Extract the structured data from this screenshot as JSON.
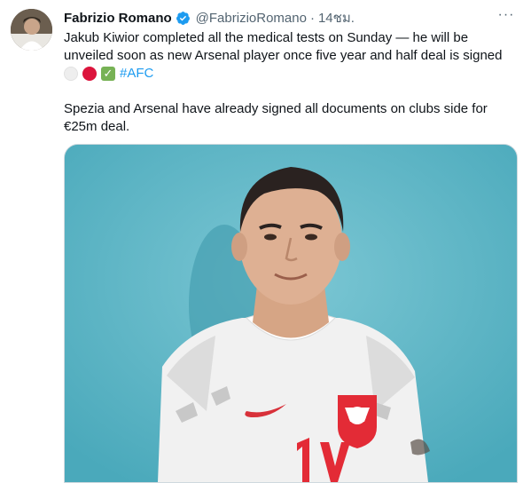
{
  "tweet": {
    "author_name": "Fabrizio Romano",
    "handle": "@FabrizioRomano",
    "separator": "·",
    "time": "14ชม.",
    "more_label": "···",
    "text_line1": "Jakub Kiwior completed all the medical tests on Sunday — he will be",
    "text_line2": "unveiled soon as new Arsenal player once five year and half deal is signed",
    "hashtag": "#AFC",
    "text_para2_line1": "Spezia and Arsenal have already signed all documents on clubs side for",
    "text_para2_line2": "€25m deal.",
    "check_glyph": "✓"
  },
  "icons": {
    "verified": "verified-badge-icon",
    "more": "more-options-icon",
    "flag_white": "white-circle-emoji",
    "flag_red": "red-circle-emoji",
    "check": "check-mark-emoji"
  },
  "colors": {
    "link": "#1d9bf0",
    "secondary_text": "#536471",
    "photo_background": "#5fb9c9"
  }
}
